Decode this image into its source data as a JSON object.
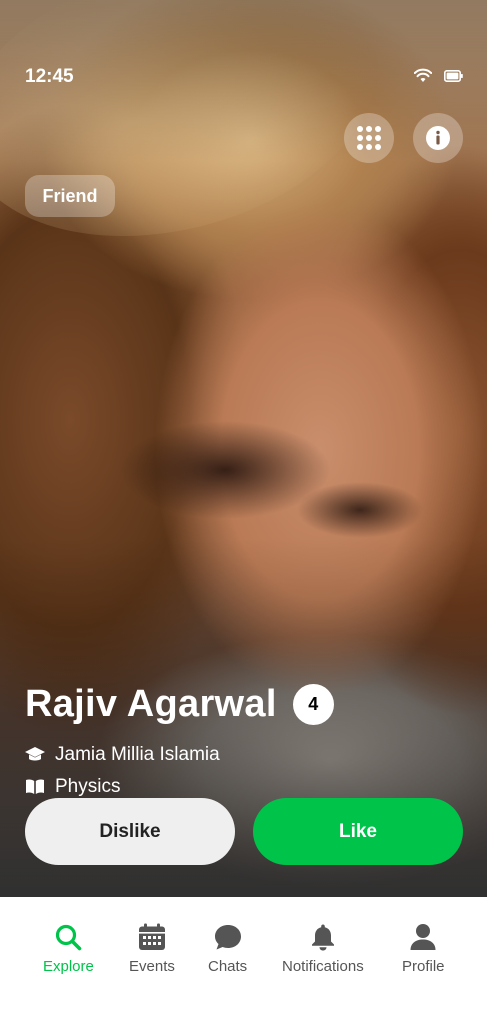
{
  "status_bar": {
    "time": "12:45"
  },
  "profile": {
    "tag": "Friend",
    "name": "Rajiv Agarwal",
    "badge": "4",
    "university": "Jamia Millia Islamia",
    "subject": "Physics"
  },
  "actions": {
    "dislike": "Dislike",
    "like": "Like"
  },
  "tabs": [
    {
      "label": "Explore",
      "icon": "search-icon",
      "active": true
    },
    {
      "label": "Events",
      "icon": "calendar-icon"
    },
    {
      "label": "Chats",
      "icon": "chat-icon"
    },
    {
      "label": "Notifications",
      "icon": "bell-icon"
    },
    {
      "label": "Profile",
      "icon": "user-icon"
    }
  ],
  "colors": {
    "accent": "#00c34a",
    "tab_inactive": "#555555"
  }
}
